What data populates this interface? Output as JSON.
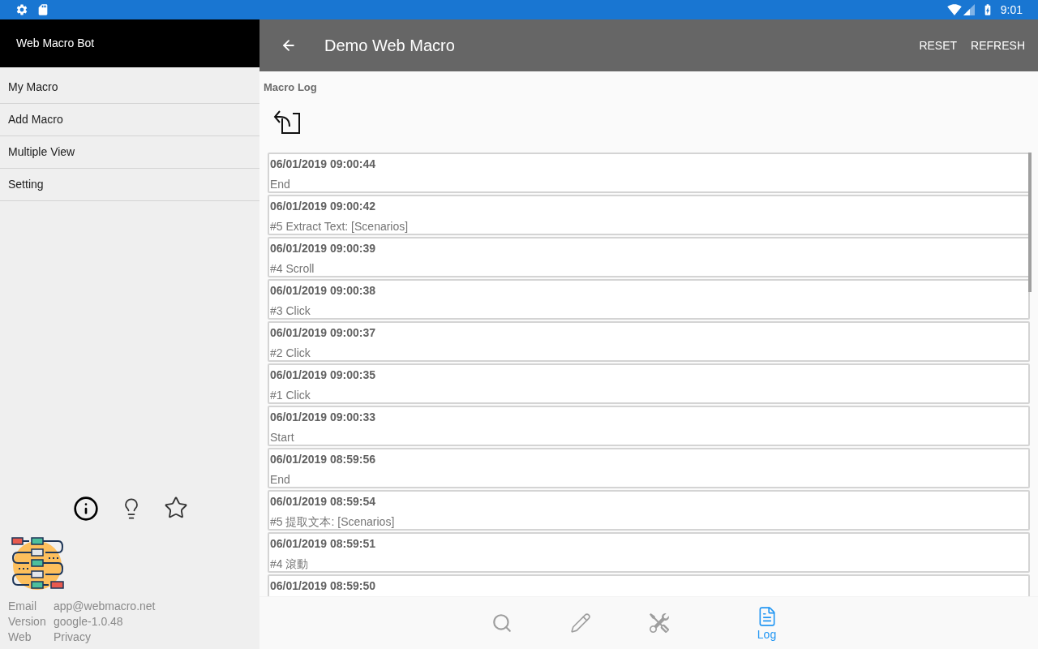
{
  "status_bar": {
    "time": "9:01"
  },
  "sidebar": {
    "title": "Web Macro Bot",
    "items": [
      {
        "label": "My Macro"
      },
      {
        "label": "Add Macro"
      },
      {
        "label": "Multiple View"
      },
      {
        "label": "Setting"
      }
    ],
    "info": [
      {
        "label": "Email",
        "value": "app@webmacro.net"
      },
      {
        "label": "Version",
        "value": "google-1.0.48"
      },
      {
        "label": "Web",
        "value": "Privacy"
      }
    ]
  },
  "toolbar": {
    "title": "Demo Web Macro",
    "actions": [
      "RESET",
      "REFRESH"
    ]
  },
  "log": {
    "heading": "Macro Log",
    "entries": [
      {
        "time": "06/01/2019 09:00:44",
        "message": "End"
      },
      {
        "time": "06/01/2019 09:00:42",
        "message": "#5 Extract Text: [Scenarios]"
      },
      {
        "time": "06/01/2019 09:00:39",
        "message": "#4 Scroll"
      },
      {
        "time": "06/01/2019 09:00:38",
        "message": "#3 Click"
      },
      {
        "time": "06/01/2019 09:00:37",
        "message": "#2 Click"
      },
      {
        "time": "06/01/2019 09:00:35",
        "message": "#1 Click"
      },
      {
        "time": "06/01/2019 09:00:33",
        "message": "Start"
      },
      {
        "time": "06/01/2019 08:59:56",
        "message": "End"
      },
      {
        "time": "06/01/2019 08:59:54",
        "message": "#5 提取文本: [Scenarios]"
      },
      {
        "time": "06/01/2019 08:59:51",
        "message": "#4 滾動"
      },
      {
        "time": "06/01/2019 08:59:50"
      }
    ]
  },
  "bottom_nav": [
    {
      "kind": "search",
      "selected": false
    },
    {
      "kind": "edit",
      "selected": false
    },
    {
      "kind": "tools",
      "selected": false
    },
    {
      "kind": "log",
      "selected": true,
      "label": "Log"
    }
  ]
}
